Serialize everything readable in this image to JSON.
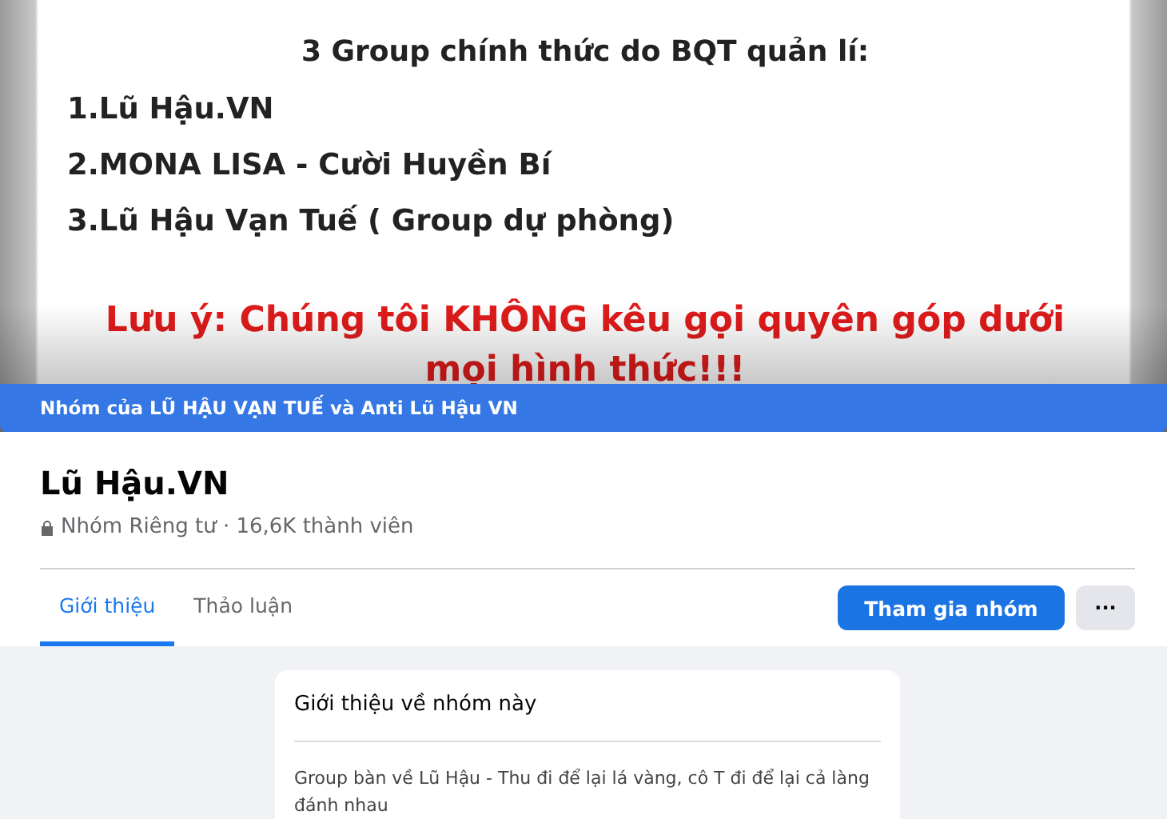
{
  "cover": {
    "heading": "3 Group chính thức do BQT quản lí:",
    "list": [
      "1.Lũ Hậu.VN",
      "2.MONA LISA - Cười Huyền Bí",
      "3.Lũ Hậu Vạn Tuế ( Group dự phòng)"
    ],
    "notice": "Lưu ý: Chúng tôi KHÔNG kêu gọi quyên góp dưới",
    "notice_cut": "mọi hình thức!!!"
  },
  "parent_bar": {
    "text": "Nhóm của LŨ HẬU VẠN TUẾ và Anti Lũ Hậu VN"
  },
  "group": {
    "name": "Lũ Hậu.VN",
    "meta": "Nhóm Riêng tư · 16,6K thành viên"
  },
  "tabs": [
    {
      "label": "Giới thiệu",
      "selected": true
    },
    {
      "label": "Thảo luận",
      "selected": false
    }
  ],
  "join_button": "Tham gia nhóm",
  "more_button": "···",
  "about": {
    "title": "Giới thiệu về nhóm này",
    "text": "Group bàn về Lũ Hậu - Thu đi để lại lá vàng, cô T đi để lại cả làng đánh nhau"
  }
}
